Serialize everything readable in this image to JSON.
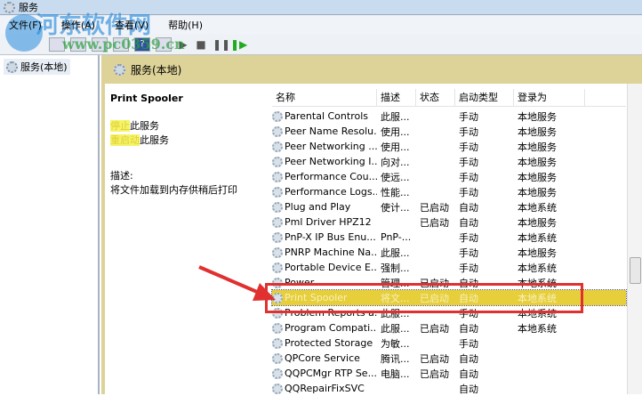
{
  "window": {
    "title": "服务"
  },
  "menu": [
    "文件(F)",
    "操作(A)",
    "查看(V)",
    "帮助(H)"
  ],
  "tree": {
    "item": "服务(本地)"
  },
  "header": {
    "title": "服务(本地)"
  },
  "details": {
    "name": "Print Spooler",
    "stop_link": "停止",
    "stop_suffix": "此服务",
    "restart_link": "重启动",
    "restart_suffix": "此服务",
    "desc_label": "描述:",
    "desc": "将文件加载到内存供稍后打印"
  },
  "columns": [
    "名称",
    "描述",
    "状态",
    "启动类型",
    "登录为"
  ],
  "rows": [
    [
      "Parental Controls",
      "此服...",
      "",
      "手动",
      "本地服务"
    ],
    [
      "Peer Name Resolu...",
      "使用...",
      "",
      "手动",
      "本地服务"
    ],
    [
      "Peer Networking ...",
      "使用...",
      "",
      "手动",
      "本地服务"
    ],
    [
      "Peer Networking I...",
      "向对...",
      "",
      "手动",
      "本地服务"
    ],
    [
      "Performance Cou...",
      "使远...",
      "",
      "手动",
      "本地服务"
    ],
    [
      "Performance Logs...",
      "性能...",
      "",
      "手动",
      "本地服务"
    ],
    [
      "Plug and Play",
      "使计...",
      "已启动",
      "自动",
      "本地系统"
    ],
    [
      "Pml Driver HPZ12",
      "",
      "已启动",
      "自动",
      "本地服务"
    ],
    [
      "PnP-X IP Bus Enu...",
      "PnP-...",
      "",
      "手动",
      "本地系统"
    ],
    [
      "PNRP Machine Na...",
      "此服...",
      "",
      "手动",
      "本地服务"
    ],
    [
      "Portable Device E...",
      "强制...",
      "",
      "手动",
      "本地系统"
    ],
    [
      "Power",
      "管理...",
      "已启动",
      "自动",
      "本地系统"
    ],
    [
      "Print Spooler",
      "将文...",
      "已启动",
      "自动",
      "本地系统"
    ],
    [
      "Problem Reports a...",
      "此服...",
      "",
      "手动",
      "本地系统"
    ],
    [
      "Program Compati...",
      "此服...",
      "已启动",
      "自动",
      "本地系统"
    ],
    [
      "Protected Storage",
      "为敏...",
      "",
      "手动",
      ""
    ],
    [
      "QPCore Service",
      "腾讯...",
      "已启动",
      "自动",
      ""
    ],
    [
      "QQPCMgr RTP Se...",
      "电脑...",
      "已启动",
      "自动",
      ""
    ],
    [
      "QQRepairFixSVC",
      "",
      "",
      "自动",
      ""
    ]
  ],
  "selected_index": 12,
  "watermark": {
    "text": "河东软件网",
    "url": "www.pc0359.cn"
  }
}
